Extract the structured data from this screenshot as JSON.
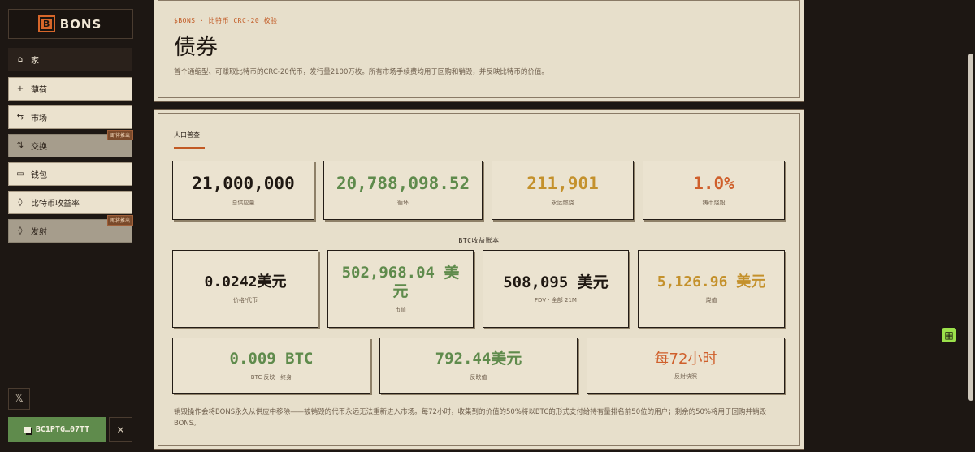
{
  "brand": {
    "logo_letter": "B",
    "name": "BONS"
  },
  "sidebar": {
    "items": [
      {
        "icon": "home-icon",
        "glyph": "⌂",
        "label": "家"
      },
      {
        "icon": "plus-icon",
        "glyph": "+",
        "label": "薄荷"
      },
      {
        "icon": "arrows-horizontal-icon",
        "glyph": "⇆",
        "label": "市场"
      },
      {
        "icon": "swap-vertical-icon",
        "glyph": "⇅",
        "label": "交换",
        "badge": "即将推出"
      },
      {
        "icon": "wallet-icon",
        "glyph": "▭",
        "label": "钱包"
      },
      {
        "icon": "droplet-icon",
        "glyph": "◊",
        "label": "比特币收益率"
      },
      {
        "icon": "flame-icon",
        "glyph": "◊",
        "label": "发射",
        "badge": "即将推出"
      }
    ],
    "x_glyph": "𝕏",
    "wallet_label": "BC1PTG…07TT",
    "close_glyph": "✕"
  },
  "header": {
    "kicker": "$BONS · 比特币 CRC-20 校验",
    "title": "债券",
    "description": "首个通缩型、可赚取比特币的CRC-20代币，发行量2100万枚。所有市场手续费均用于回购和销毁，并反映比特币的价值。"
  },
  "main": {
    "tab": "人口普查",
    "stats_row1": [
      {
        "value": "21,000,000",
        "label": "总供应量",
        "color": "#1f1812"
      },
      {
        "value": "20,788,098.52",
        "label": "循环",
        "color": "#5f8b4c"
      },
      {
        "value": "211,901",
        "label": "永远燃烧",
        "color": "#c4912c"
      },
      {
        "value": "1.0%",
        "label": "铸币烧毁",
        "color": "#cf5f2b"
      }
    ],
    "section_title": "BTC收益账本",
    "stats_row2": [
      {
        "value": "0.0242美元",
        "label": "价格/代币"
      },
      {
        "value": "502,968.04 美元",
        "label": "市值"
      },
      {
        "value": "508,095 美元",
        "label": "FDV · 全部 21M"
      },
      {
        "value": "5,126.96 美元",
        "label": "烧值"
      }
    ],
    "stats_row3": [
      {
        "value": "0.009 BTC",
        "label": "BTC 反映 · 终身"
      },
      {
        "value": "792.44美元",
        "label": "反映值"
      },
      {
        "value": "每72小时",
        "label": "反射快照"
      }
    ],
    "footer": "销毁操作会将BONS永久从供应中移除——被销毁的代币永远无法重新进入市场。每72小时，收集到的价值的50%将以BTC的形式支付给持有量排名前50位的用户；剩余的50%将用于回购并销毁BONS。"
  },
  "floating_widget": {
    "icon": "grid-widget-icon",
    "glyph": "▦"
  }
}
